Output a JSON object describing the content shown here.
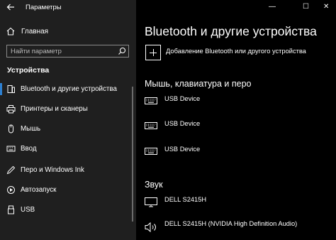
{
  "window": {
    "title": "Параметры",
    "controls": {
      "minimize": "—",
      "maximize": "☐",
      "close": "✕"
    }
  },
  "sidebar": {
    "home_label": "Главная",
    "search_placeholder": "Найти параметр",
    "section_title": "Устройства",
    "items": [
      {
        "label": "Bluetooth и другие устройства",
        "icon": "bluetooth-devices-icon",
        "selected": true
      },
      {
        "label": "Принтеры и сканеры",
        "icon": "printer-icon",
        "selected": false
      },
      {
        "label": "Мышь",
        "icon": "mouse-icon",
        "selected": false
      },
      {
        "label": "Ввод",
        "icon": "keyboard-input-icon",
        "selected": false
      },
      {
        "label": "Перо и Windows Ink",
        "icon": "pen-icon",
        "selected": false
      },
      {
        "label": "Автозапуск",
        "icon": "autoplay-icon",
        "selected": false
      },
      {
        "label": "USB",
        "icon": "usb-icon",
        "selected": false
      }
    ]
  },
  "main": {
    "title": "Bluetooth и другие устройства",
    "add_device_label": "Добавление Bluetooth или другого устройства",
    "groups": [
      {
        "title": "Мышь, клавиатура и перо",
        "devices": [
          {
            "label": "USB Device",
            "icon": "keyboard-icon"
          },
          {
            "label": "USB Device",
            "icon": "keyboard-icon"
          },
          {
            "label": "USB Device",
            "icon": "keyboard-icon"
          }
        ]
      },
      {
        "title": "Звук",
        "devices": [
          {
            "label": "DELL S2415H",
            "icon": "monitor-icon"
          },
          {
            "label": "DELL S2415H (NVIDIA High Definition Audio)",
            "icon": "speaker-icon"
          }
        ]
      }
    ]
  },
  "colors": {
    "sidebar_bg": "#1f1f1f",
    "main_bg": "#000000",
    "accent": "#2d7fd0"
  }
}
